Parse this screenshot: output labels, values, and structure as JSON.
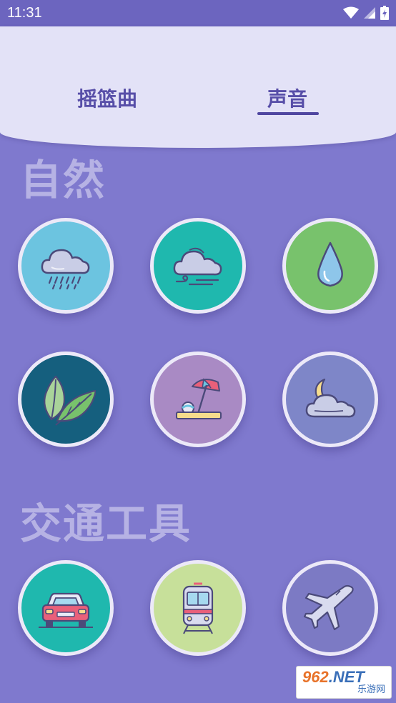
{
  "status_bar": {
    "time": "11:31"
  },
  "tabs": [
    {
      "label": "摇篮曲",
      "active": false
    },
    {
      "label": "声音",
      "active": true
    }
  ],
  "sections": {
    "nature": {
      "title": "自然",
      "items": [
        {
          "icon": "rain-cloud-icon",
          "color": "#6cc4e0"
        },
        {
          "icon": "wind-cloud-icon",
          "color": "#1fb8ae"
        },
        {
          "icon": "water-drop-icon",
          "color": "#78c26c"
        },
        {
          "icon": "leaves-icon",
          "color": "#155f7e"
        },
        {
          "icon": "beach-umbrella-icon",
          "color": "#a98ac4"
        },
        {
          "icon": "moon-cloud-icon",
          "color": "#7e86c8"
        }
      ]
    },
    "transport": {
      "title": "交通工具",
      "items": [
        {
          "icon": "car-icon",
          "color": "#1fb8ae"
        },
        {
          "icon": "train-icon",
          "color": "#c7e09a"
        },
        {
          "icon": "airplane-icon",
          "color": "#7c7ac4"
        }
      ]
    }
  },
  "watermark": {
    "brand_number": "962",
    "brand_suffix": ".NET",
    "brand_text": "乐游网"
  }
}
